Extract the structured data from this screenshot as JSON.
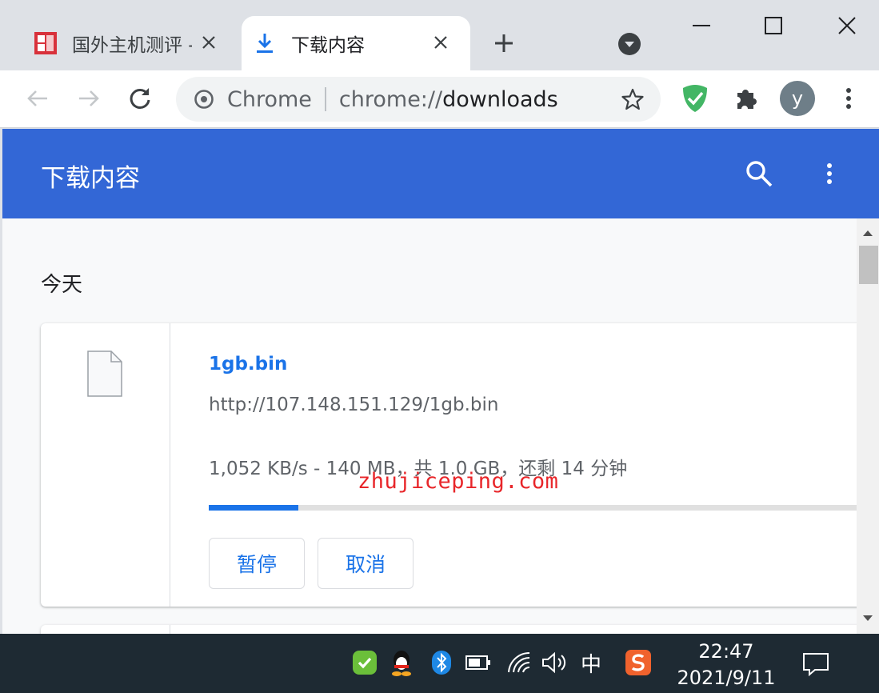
{
  "browser": {
    "tabs": [
      {
        "title": "国外主机测评 - ",
        "active": false,
        "icon": "site-favicon"
      },
      {
        "title": "下载内容",
        "active": true,
        "icon": "download-icon"
      }
    ],
    "omnibox": {
      "origin_label": "Chrome",
      "url_scheme": "chrome://",
      "url_path": "downloads"
    },
    "profile_initial": "y"
  },
  "page": {
    "title": "下载内容",
    "section_date": "今天",
    "download": {
      "file_name": "1gb.bin",
      "url": "http://107.148.151.129/1gb.bin",
      "status": "1,052 KB/s - 140 MB，共 1.0 GB，还剩 14 分钟",
      "progress_percent": 13.7,
      "pause_label": "暂停",
      "cancel_label": "取消"
    },
    "watermark": "zhujiceping.com"
  },
  "taskbar": {
    "ime": "中",
    "time": "22:47",
    "date": "2021/9/11"
  },
  "colors": {
    "header_blue": "#3367d6",
    "link_blue": "#1a73e8",
    "watermark_red": "#e8262a"
  }
}
